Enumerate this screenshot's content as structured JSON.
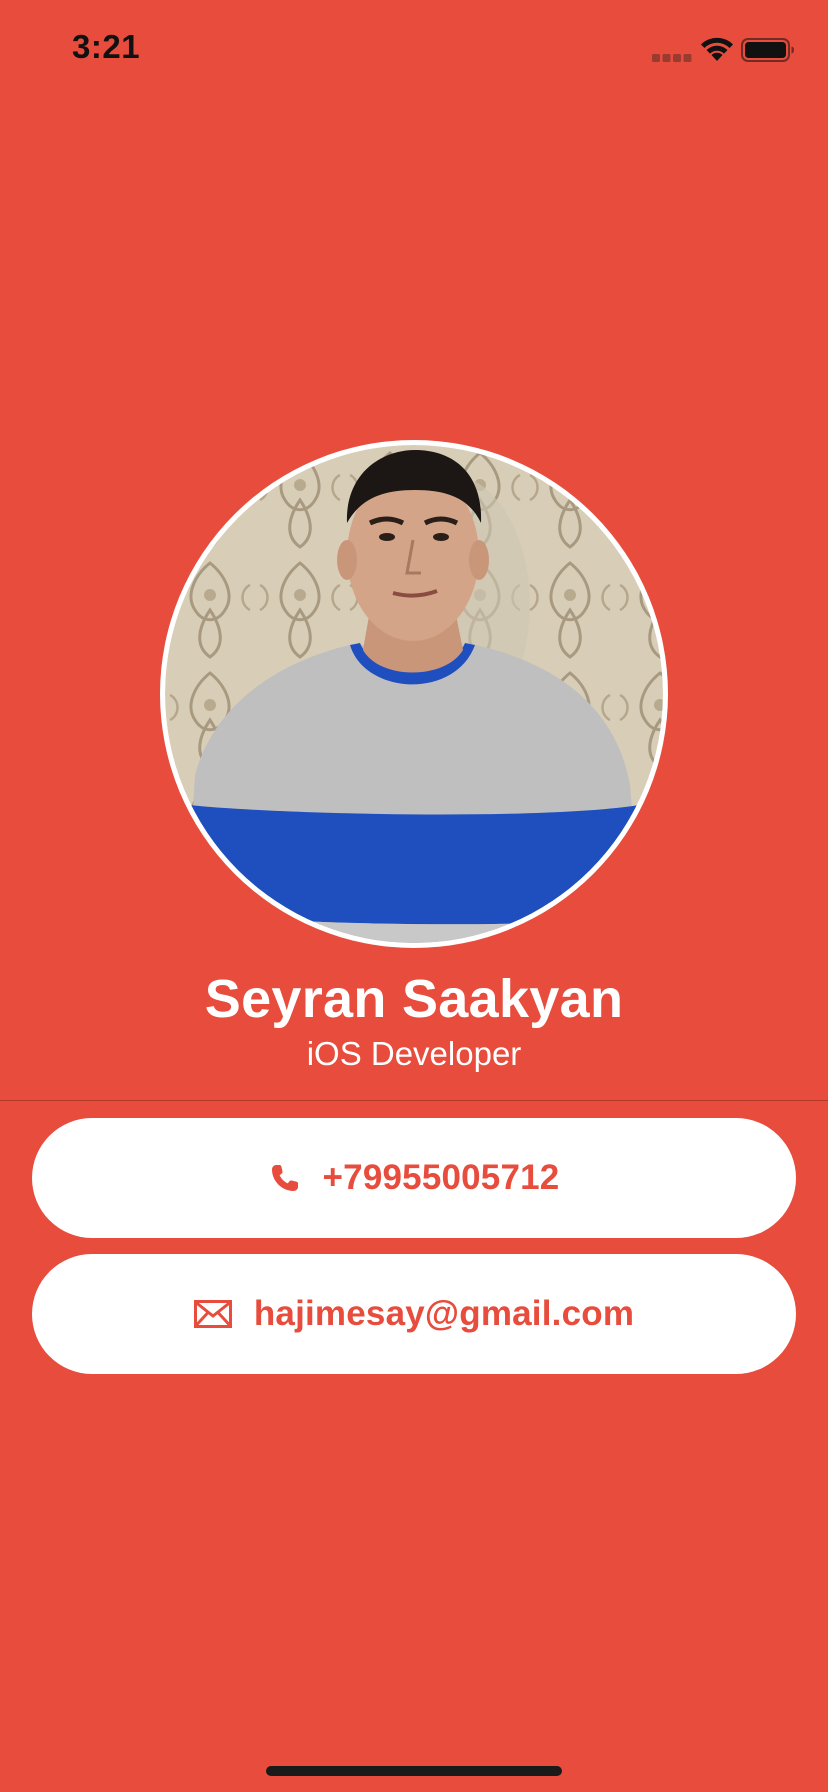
{
  "status_bar": {
    "time": "3:21",
    "icons": [
      "cellular-signal-icon",
      "wifi-icon",
      "battery-icon"
    ]
  },
  "profile": {
    "avatar": "profile-photo",
    "name": "Seyran Saakyan",
    "title": "iOS Developer"
  },
  "contacts": {
    "phone": {
      "icon": "phone-icon",
      "value": "+79955005712"
    },
    "email": {
      "icon": "envelope-icon",
      "value": "hajimesay@gmail.com"
    }
  },
  "colors": {
    "background": "#E74C3C",
    "card": "#FFFFFF",
    "accent_text": "#E74C3C",
    "light_text": "#FFFFFF"
  }
}
